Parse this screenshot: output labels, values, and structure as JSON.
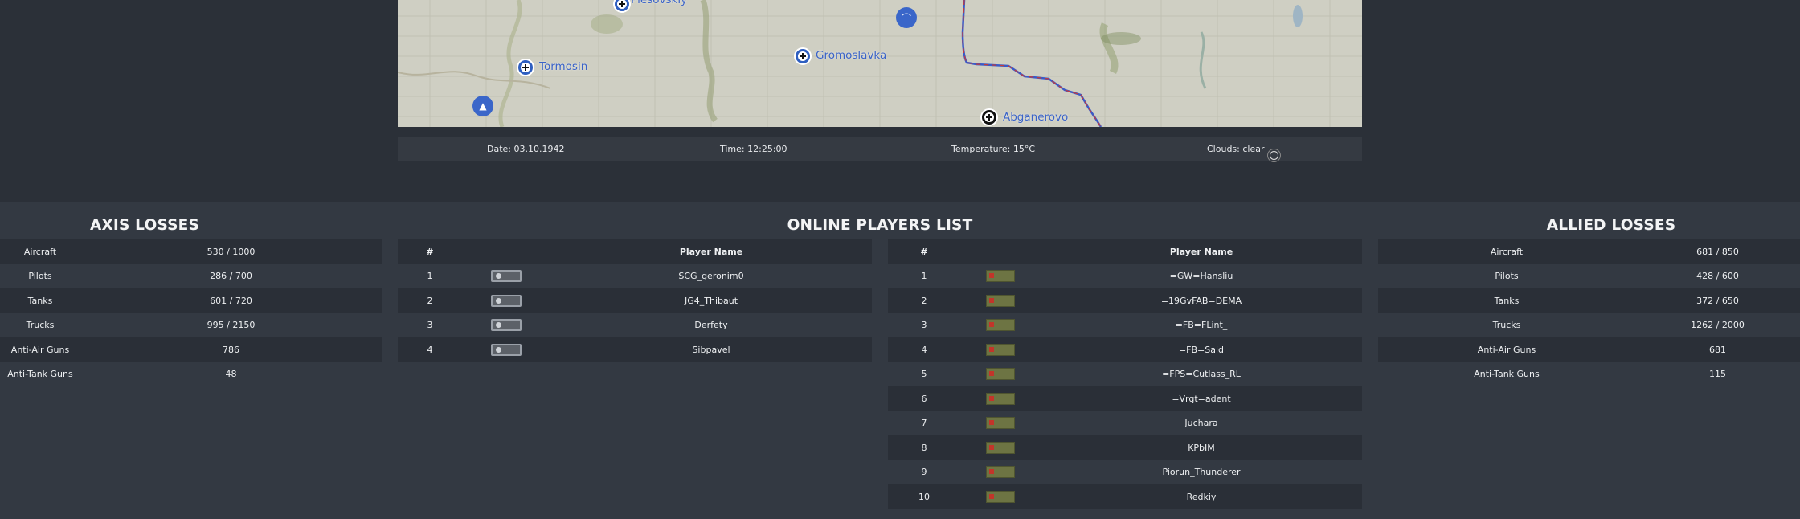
{
  "map": {
    "labels": [
      "Plesovskiy",
      "Tormosin",
      "Gromoslavka",
      "Abganerovo"
    ]
  },
  "weather": {
    "date": "Date: 03.10.1942",
    "time": "Time: 12:25:00",
    "temperature": "Temperature: 15°C",
    "clouds": "Clouds: clear"
  },
  "axis_losses": {
    "title": "AXIS LOSSES",
    "rows": [
      {
        "label": "Aircraft",
        "value": "530 / 1000"
      },
      {
        "label": "Pilots",
        "value": "286 / 700"
      },
      {
        "label": "Tanks",
        "value": "601 / 720"
      },
      {
        "label": "Trucks",
        "value": "995 / 2150"
      },
      {
        "label": "Anti-Air Guns",
        "value": "786"
      },
      {
        "label": "Anti-Tank Guns",
        "value": "48"
      }
    ]
  },
  "players": {
    "title": "ONLINE PLAYERS LIST",
    "header_num": "#",
    "header_name": "Player Name",
    "axis": [
      {
        "num": "1",
        "name": "SCG_geronim0"
      },
      {
        "num": "2",
        "name": "JG4_Thibaut"
      },
      {
        "num": "3",
        "name": "Derfety"
      },
      {
        "num": "4",
        "name": "Sibpavel"
      }
    ],
    "allied": [
      {
        "num": "1",
        "name": "=GW=Hansliu"
      },
      {
        "num": "2",
        "name": "=19GvFAB=DEMA"
      },
      {
        "num": "3",
        "name": "=FB=FLint_"
      },
      {
        "num": "4",
        "name": "=FB=Said"
      },
      {
        "num": "5",
        "name": "=FPS=Cutlass_RL"
      },
      {
        "num": "6",
        "name": "=Vrgt=adent"
      },
      {
        "num": "7",
        "name": "Juchara"
      },
      {
        "num": "8",
        "name": "KPbIM"
      },
      {
        "num": "9",
        "name": "Piorun_Thunderer"
      },
      {
        "num": "10",
        "name": "Redkiy"
      }
    ]
  },
  "allied_losses": {
    "title": "ALLIED LOSSES",
    "rows": [
      {
        "label": "Aircraft",
        "value": "681 / 850"
      },
      {
        "label": "Pilots",
        "value": "428 / 600"
      },
      {
        "label": "Tanks",
        "value": "372 / 650"
      },
      {
        "label": "Trucks",
        "value": "1262 / 2000"
      },
      {
        "label": "Anti-Air Guns",
        "value": "681"
      },
      {
        "label": "Anti-Tank Guns",
        "value": "115"
      }
    ]
  }
}
